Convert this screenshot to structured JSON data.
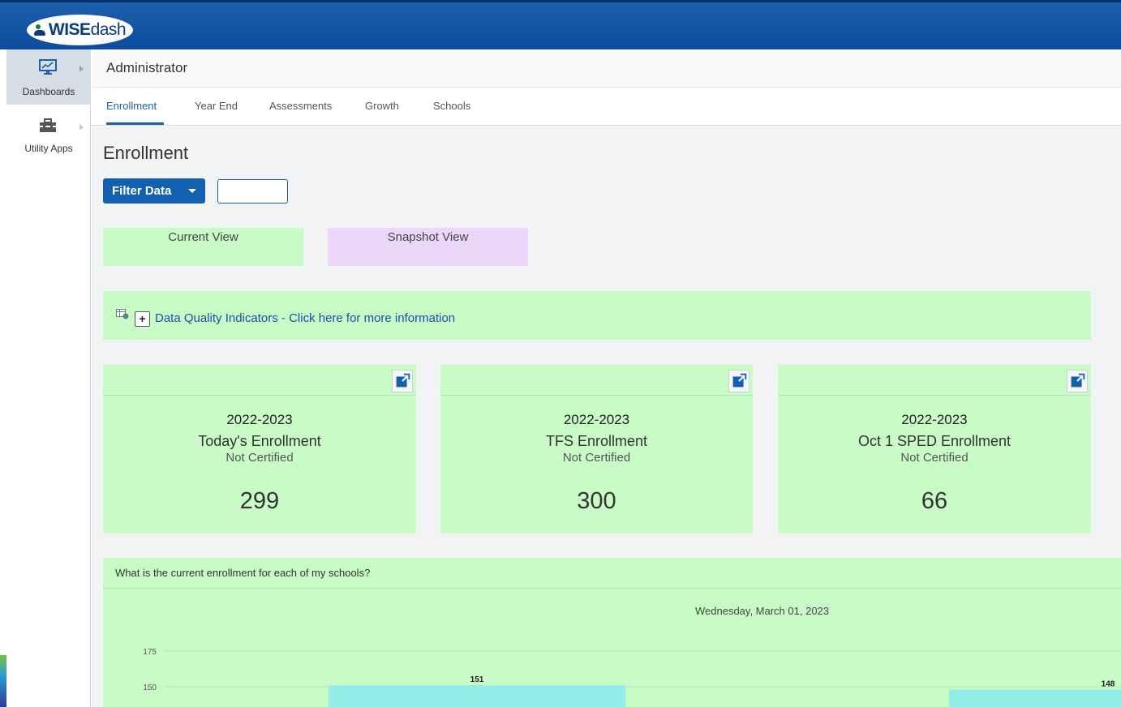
{
  "app": {
    "logo_text_bold": "WISE",
    "logo_text_rest": "dash"
  },
  "rail": {
    "items": [
      {
        "label": "Dashboards",
        "icon": "dashboard-monitor-icon",
        "active": true
      },
      {
        "label": "Utility Apps",
        "icon": "toolbox-icon",
        "active": false
      }
    ]
  },
  "header": {
    "title": "Administrator",
    "tabs": [
      {
        "label": "Enrollment",
        "active": true
      },
      {
        "label": "Year End"
      },
      {
        "label": "Assessments"
      },
      {
        "label": "Growth"
      },
      {
        "label": "Schools"
      }
    ]
  },
  "main": {
    "title": "Enrollment",
    "filter_button": "Filter Data",
    "filter_input_value": "",
    "views": {
      "current": "Current View",
      "snapshot": "Snapshot View"
    },
    "data_quality": {
      "plus": "+",
      "text": "Data Quality Indicators - Click here for more information"
    },
    "cards": [
      {
        "year": "2022-2023",
        "name": "Today's Enrollment",
        "status": "Not Certified",
        "value": "299"
      },
      {
        "year": "2022-2023",
        "name": "TFS Enrollment",
        "status": "Not Certified",
        "value": "300"
      },
      {
        "year": "2022-2023",
        "name": "Oct 1 SPED Enrollment",
        "status": "Not Certified",
        "value": "66"
      }
    ],
    "chart": {
      "question": "What is the current enrollment for each of my schools?",
      "date": "Wednesday, March 01, 2023"
    }
  },
  "colors": {
    "brand_blue": "#1261b0",
    "card_green": "#c9fbc6",
    "snapshot_purple": "#ecd7fb",
    "bar_cyan": "#92ede8"
  },
  "chart_data": {
    "type": "bar",
    "y_ticks": [
      150,
      175
    ],
    "bars": [
      {
        "value": 151,
        "label": "151"
      },
      {
        "value": 148,
        "label": "148"
      }
    ],
    "grid": true
  }
}
